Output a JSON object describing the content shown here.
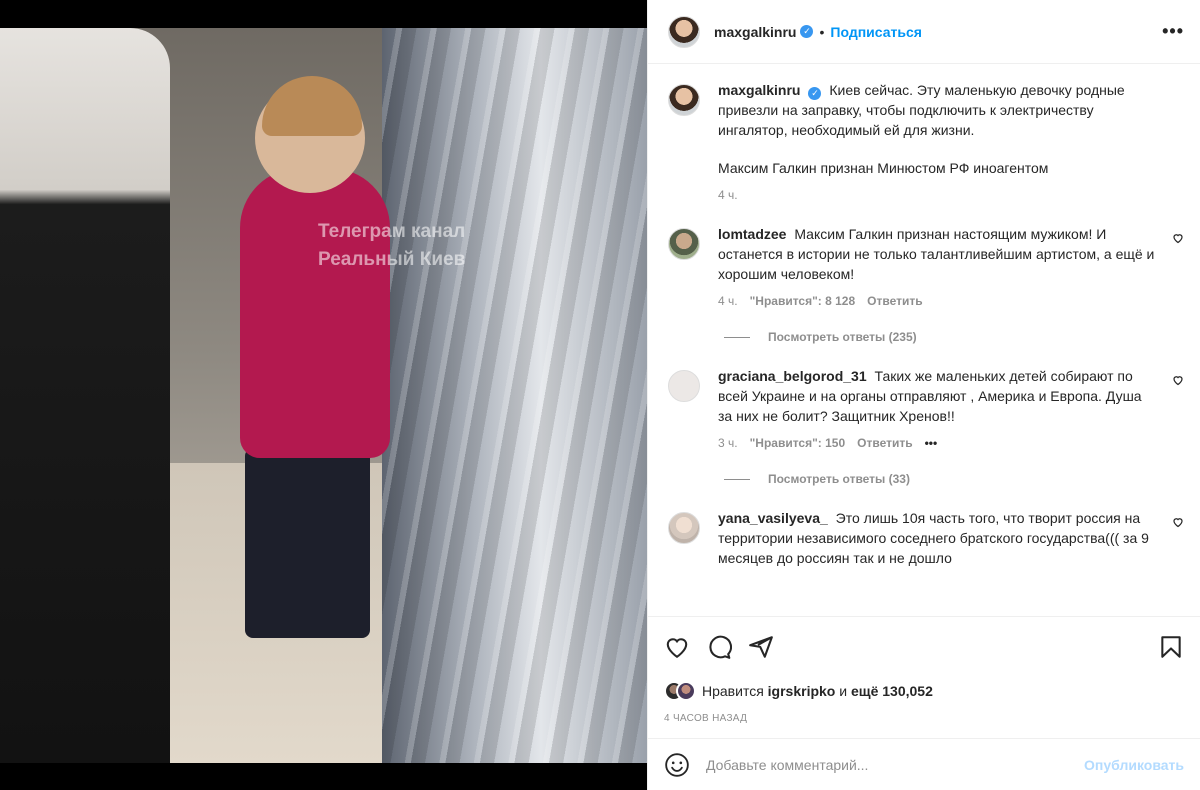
{
  "media": {
    "watermark_line1": "Телеграм канал",
    "watermark_line2": "Реальный Киев"
  },
  "header": {
    "username": "maxgalkinru",
    "verified_icon": "verified-badge-icon",
    "separator": "•",
    "follow_label": "Подписаться",
    "more_label": "•••"
  },
  "caption": {
    "username": "maxgalkinru",
    "text": "Киев сейчас. Эту маленькую девочку родные привезли на заправку, чтобы подключить к электричеству ингалятор, необходимый ей для жизни.",
    "extra": "Максим Галкин признан Минюстом РФ иноагентом",
    "time": "4 ч."
  },
  "comments": [
    {
      "username": "lomtadzee",
      "text": "Максим Галкин признан настоящим мужиком! И останется в истории не только талантливейшим артистом, а ещё и хорошим человеком!",
      "time": "4 ч.",
      "likes": "\"Нравится\": 8 128",
      "reply": "Ответить",
      "view_replies": "Посмотреть ответы (235)"
    },
    {
      "username": "graciana_belgorod_31",
      "text": "Таких же маленьких детей собирают по всей Украине и на органы отправляют , Америка и Европа. Душа за них не болит? Защитник Хренов!!",
      "time": "3 ч.",
      "likes": "\"Нравится\": 150",
      "reply": "Ответить",
      "more": "•••",
      "view_replies": "Посмотреть ответы (33)"
    },
    {
      "username": "yana_vasilyeva_",
      "text": "Это лишь 10я часть того, что творит россия на территории независимого соседнего братского государства((( за 9 месяцев до россиян так и не дошло"
    }
  ],
  "actions": {
    "liked_by_prefix": "Нравится",
    "liked_by_user": "igrskripko",
    "liked_by_and": "и",
    "liked_by_count": "ещё 130,052",
    "timestamp": "4 ЧАСОВ НАЗАД"
  },
  "add_comment": {
    "placeholder": "Добавьте комментарий...",
    "publish_label": "Опубликовать"
  },
  "colors": {
    "accent": "#0095f6",
    "publish_disabled": "#b3dbff",
    "muted": "#8e8e8e"
  }
}
